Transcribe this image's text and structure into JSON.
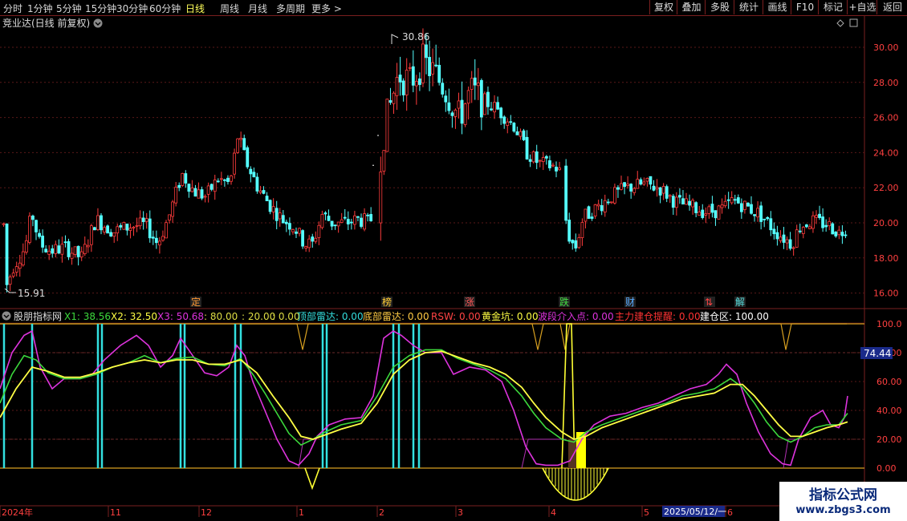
{
  "toolbar": {
    "periods": [
      "分时",
      "1分钟",
      "5分钟",
      "15分钟",
      "30分钟",
      "60分钟",
      "日线",
      "周线",
      "月线",
      "多周期",
      "更多 >"
    ],
    "active_period": "日线",
    "buttons": [
      "复权",
      "叠加",
      "多股",
      "统计",
      "画线",
      "F10",
      "标记",
      "+自选",
      "返回"
    ]
  },
  "stock": {
    "title": "竞业达(日线 前复权)",
    "high_label": "30.86",
    "low_label": "15.91",
    "price_axis": [
      "30.00",
      "28.00",
      "26.00",
      "24.00",
      "22.00",
      "20.00",
      "18.00",
      "16.00"
    ]
  },
  "event_markers": [
    {
      "label": "定",
      "color": "#ff9933"
    },
    {
      "label": "榜",
      "color": "#ffcc33"
    },
    {
      "label": "涨",
      "color": "#ff5555"
    },
    {
      "label": "跌",
      "color": "#44dd44"
    },
    {
      "label": "财",
      "color": "#55aaff"
    },
    {
      "label": "⇅",
      "color": "#ff4444"
    },
    {
      "label": "解",
      "color": "#55dddd"
    }
  ],
  "indicator": {
    "name": "股朋指标网",
    "values": [
      {
        "text": "X1: 38.56",
        "color": "#3cd83c"
      },
      {
        "text": "X2: 32.50",
        "color": "#ffff44"
      },
      {
        "text": "X3: 50.68",
        "color": "#dd33dd"
      },
      {
        "text": ": 80.00",
        "color": "#dddd44"
      },
      {
        "text": ": 20.00",
        "color": "#dddd44"
      },
      {
        "text": ": 0.00",
        "color": "#dddd44"
      },
      {
        "text": "顶部雷达: 0.00",
        "color": "#33dddd"
      },
      {
        "text": "底部雷达: 0.00",
        "color": "#ffcc44"
      },
      {
        "text": "RSW: 0.00",
        "color": "#ff4444"
      },
      {
        "text": "黄金坑: 0.00",
        "color": "#ffff44"
      },
      {
        "text": "波段介入点: 0.00",
        "color": "#dd33dd"
      },
      {
        "text": "主力建仓提醒: 0.00",
        "color": "#ff3333"
      },
      {
        "text": "建仓区: 100.00",
        "color": "#ffffff"
      }
    ],
    "axis": [
      "100.0",
      "80.00",
      "60.00",
      "40.00",
      "20.00",
      "0.00"
    ],
    "current_value": "74.44"
  },
  "time_axis": {
    "labels": [
      "2024年",
      "11",
      "12",
      "1",
      "2",
      "3",
      "4",
      "5",
      "6"
    ],
    "cursor_date": "2025/05/12/一"
  },
  "watermark": {
    "title": "指标公式网",
    "url": "www.zbgs3.com"
  },
  "colors": {
    "up": "#ff3c3c",
    "down": "#54ffff",
    "divider": "#7a1f1f"
  }
}
